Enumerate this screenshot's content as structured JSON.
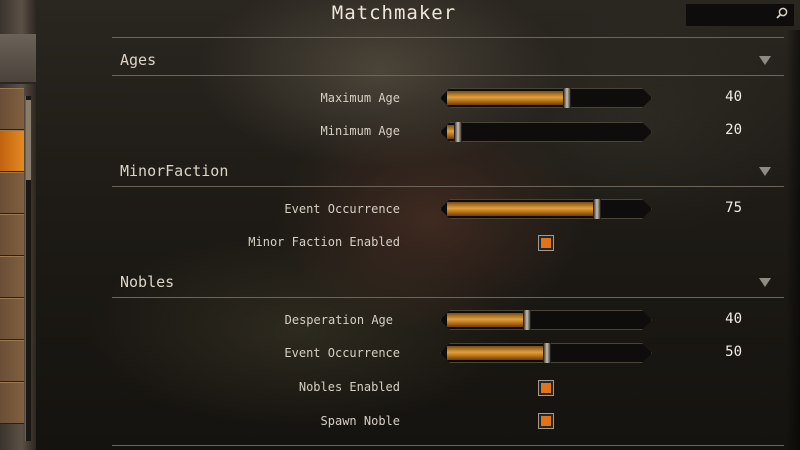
{
  "window": {
    "title": "Matchmaker",
    "search_icon": "magnifier"
  },
  "colors": {
    "accent": "#e0741a",
    "slider_fill": "#e2a03a",
    "text": "#d8d0c4"
  },
  "sections": {
    "ages": {
      "header": "Ages",
      "maximum_age": {
        "label": "Maximum Age",
        "value": "40",
        "fill_fraction": 0.6
      },
      "minimum_age": {
        "label": "Minimum Age",
        "value": "20",
        "fill_fraction": 0.05
      }
    },
    "minor_faction": {
      "header": "MinorFaction",
      "event_occurrence": {
        "label": "Event Occurrence",
        "value": "75",
        "fill_fraction": 0.75
      },
      "minor_faction_enabled": {
        "label": "Minor Faction Enabled",
        "checked": true
      }
    },
    "nobles": {
      "header": "Nobles",
      "desperation_age": {
        "label": "Desperation Age",
        "value": "40",
        "fill_fraction": 0.4
      },
      "event_occurrence": {
        "label": "Event Occurrence",
        "value": "50",
        "fill_fraction": 0.5
      },
      "nobles_enabled": {
        "label": "Nobles Enabled",
        "checked": true
      },
      "spawn_noble": {
        "label": "Spawn Noble",
        "checked": true
      }
    }
  }
}
